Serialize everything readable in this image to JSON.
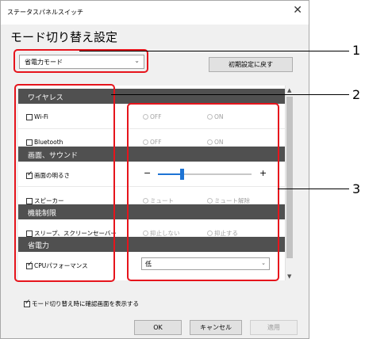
{
  "window": {
    "title": "ステータスパネルスイッチ",
    "close_glyph": "✕"
  },
  "header": {
    "title": "モード切り替え設定"
  },
  "mode": {
    "selected": "省電力モード",
    "arrow": "⌄"
  },
  "reset_button": "初期設定に戻す",
  "sections": [
    {
      "label": "ワイヤレス"
    },
    {
      "label": "画面、サウンド"
    },
    {
      "label": "機能制限"
    },
    {
      "label": "省電力"
    }
  ],
  "rows": {
    "wifi": {
      "label": "Wi-Fi",
      "checked": false,
      "opt1": "OFF",
      "opt2": "ON"
    },
    "bluetooth": {
      "label": "Bluetooth",
      "checked": false,
      "opt1": "OFF",
      "opt2": "ON"
    },
    "brightness": {
      "label": "画面の明るさ",
      "checked": true,
      "minus": "−",
      "plus": "+",
      "level": 0.25
    },
    "speaker": {
      "label": "スピーカー",
      "checked": false,
      "opt1": "ミュート",
      "opt2": "ミュート解除"
    },
    "sleep": {
      "label": "スリープ、スクリーンセーバー",
      "checked": false,
      "opt1": "抑止しない",
      "opt2": "抑止する"
    },
    "cpu": {
      "label": "CPUパフォーマンス",
      "checked": true,
      "value": "低"
    }
  },
  "footer": {
    "confirm_label": "モード切り替え時に確認画面を表示する",
    "confirm_checked": true
  },
  "buttons": {
    "ok": "OK",
    "cancel": "キャンセル",
    "apply": "適用"
  },
  "callouts": [
    "1",
    "2",
    "3"
  ],
  "colors": {
    "callout": "#e6141c",
    "section_bg": "#505050",
    "slider_thumb": "#1e74d4"
  }
}
